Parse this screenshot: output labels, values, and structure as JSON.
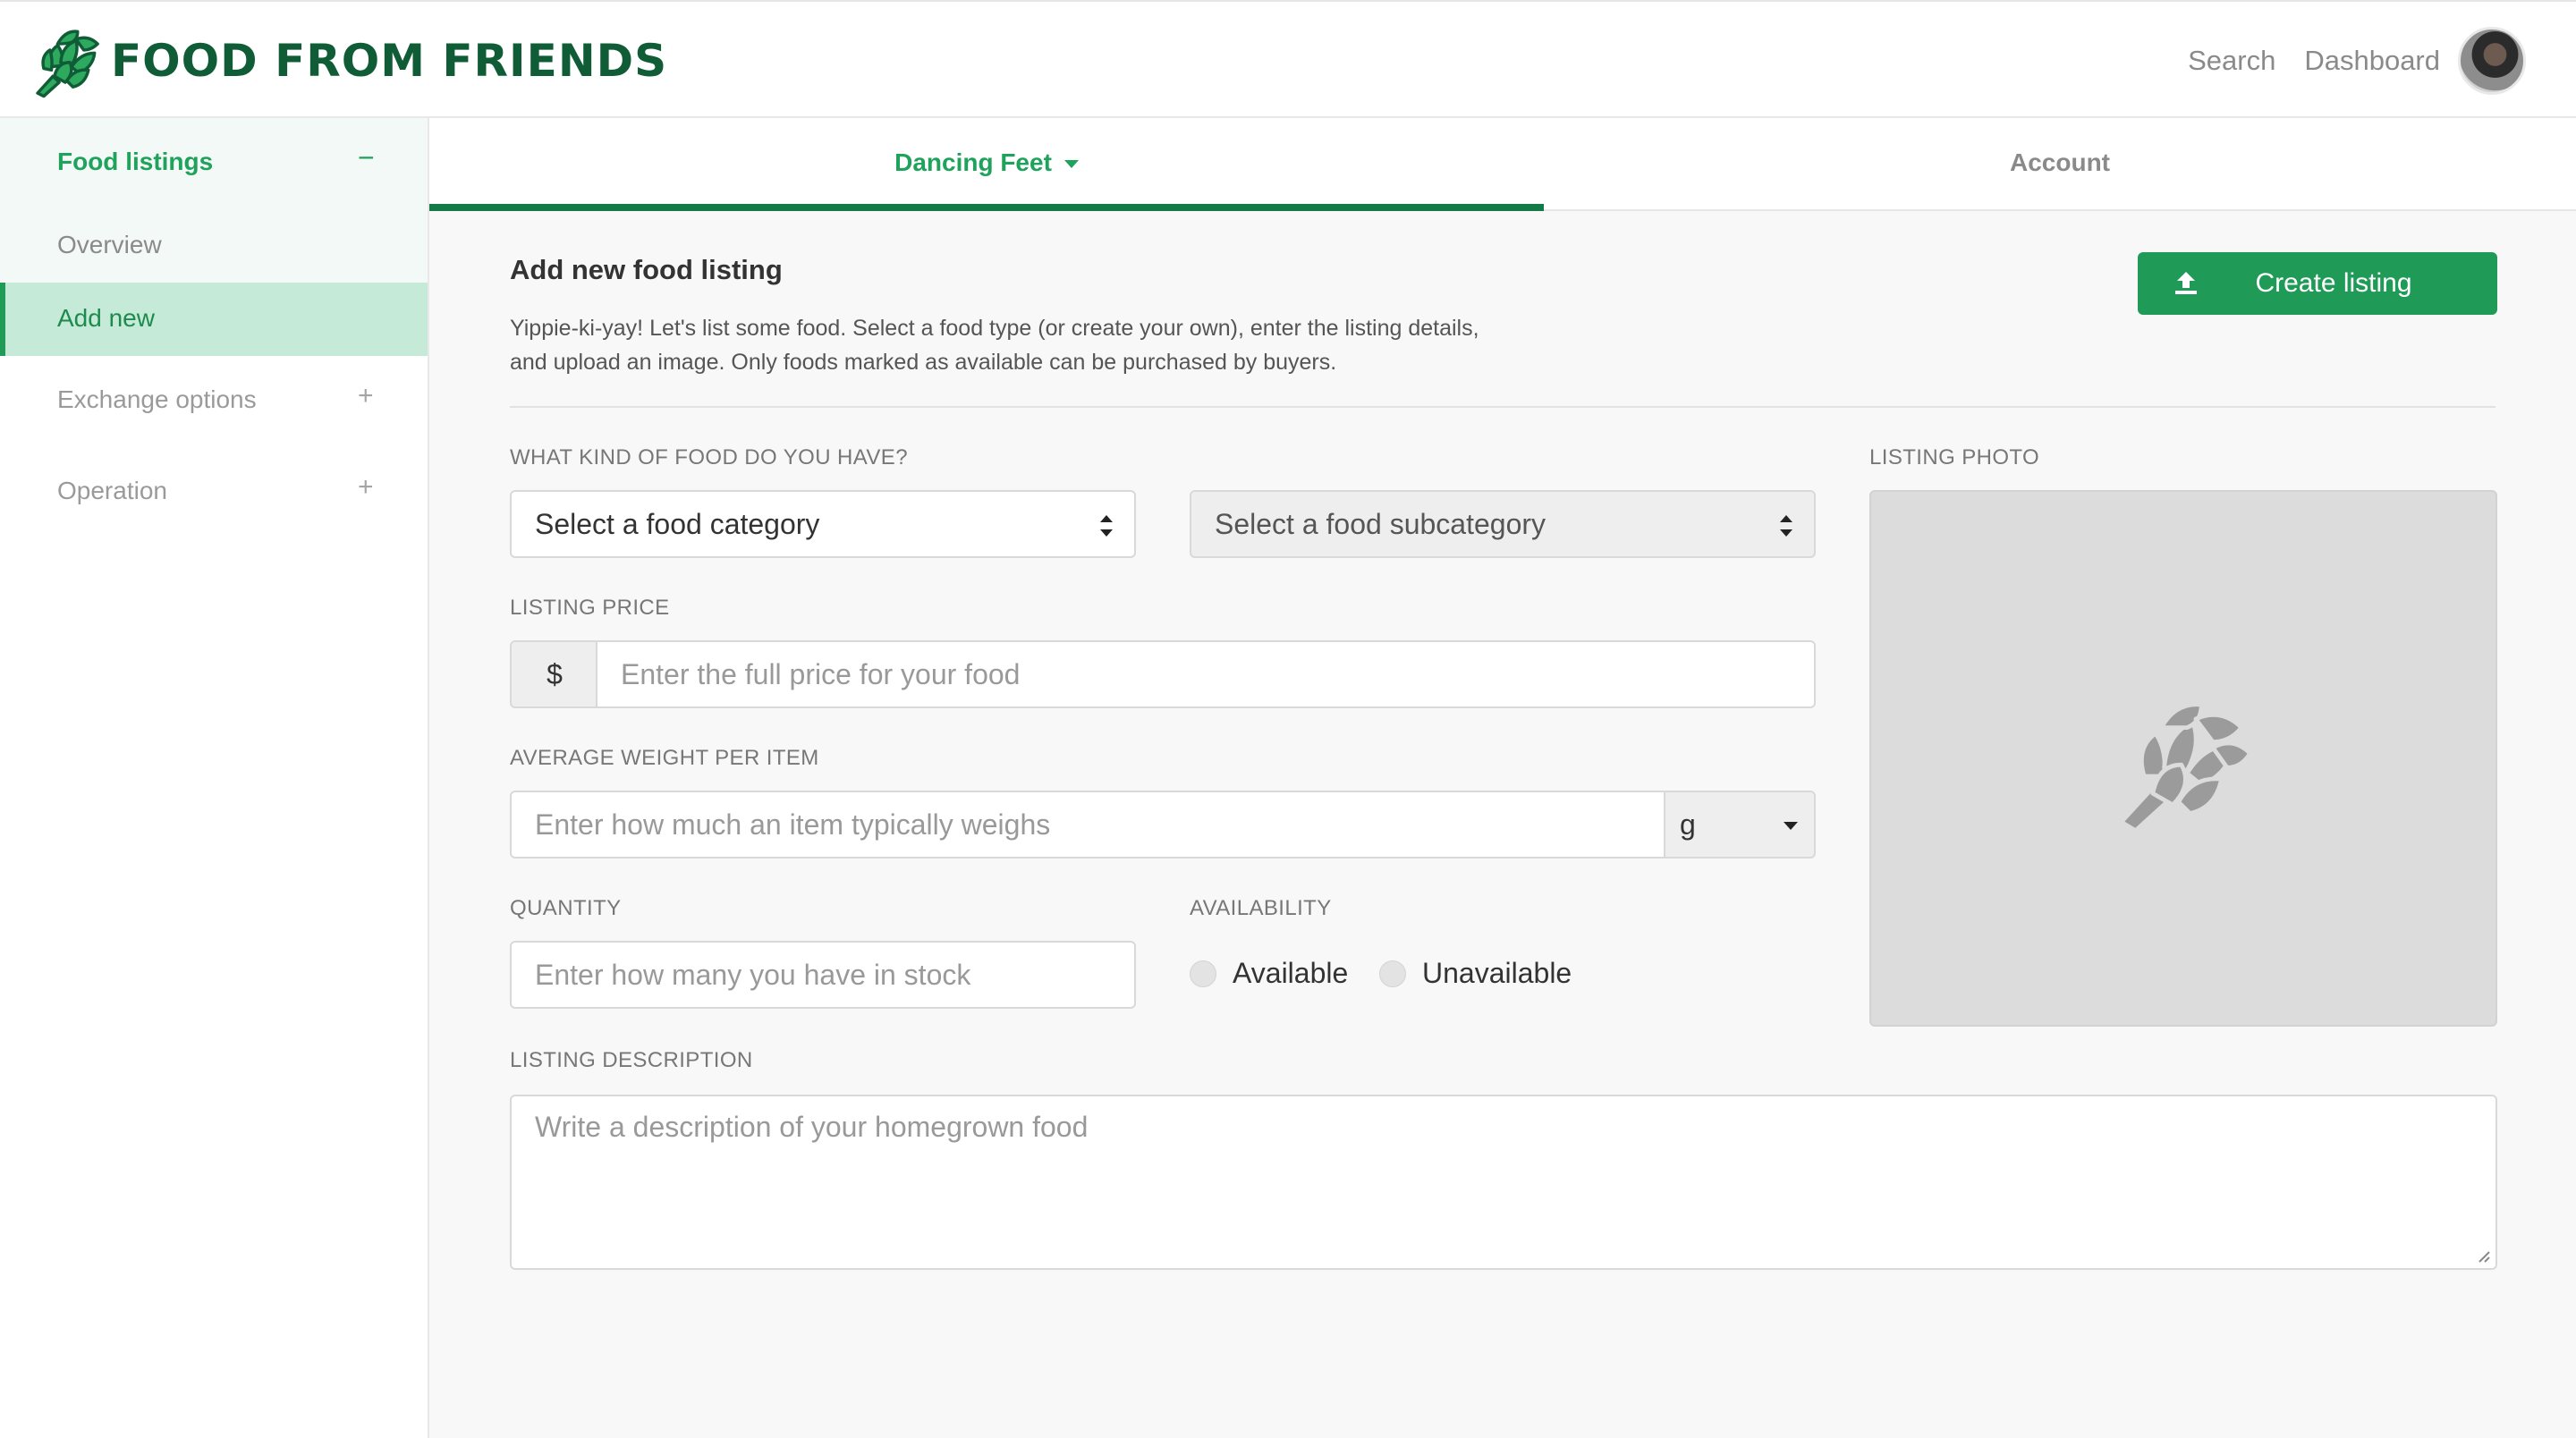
{
  "brand": {
    "name": "FOOD FROM FRIENDS",
    "color": "#0f5c37"
  },
  "topnav": {
    "search_label": "Search",
    "dashboard_label": "Dashboard"
  },
  "sidebar": {
    "section_title": "Food listings",
    "section_toggle": "−",
    "items": [
      {
        "label": "Overview",
        "active": false
      },
      {
        "label": "Add new",
        "active": true
      }
    ],
    "groups": [
      {
        "label": "Exchange options",
        "toggle": "+"
      },
      {
        "label": "Operation",
        "toggle": "+"
      }
    ]
  },
  "tabs": [
    {
      "label": "Dancing Feet",
      "active": true
    },
    {
      "label": "Account",
      "active": false
    }
  ],
  "page": {
    "title": "Add new food listing",
    "description": "Yippie-ki-yay! Let's list some food. Select a food type (or create your own), enter the listing details, and upload an image. Only foods marked as available can be purchased by buyers.",
    "create_button": "Create listing"
  },
  "form": {
    "food_kind_label": "WHAT KIND OF FOOD DO YOU HAVE?",
    "category_value": "Select a food category",
    "subcategory_value": "Select a food subcategory",
    "price_label": "LISTING PRICE",
    "price_addon": "$",
    "price_placeholder": "Enter the full price for your food",
    "weight_label": "AVERAGE WEIGHT PER ITEM",
    "weight_placeholder": "Enter how much an item typically weighs",
    "weight_unit": "g",
    "quantity_label": "QUANTITY",
    "quantity_placeholder": "Enter how many you have in stock",
    "availability_label": "AVAILABILITY",
    "availability_options": [
      "Available",
      "Unavailable"
    ],
    "photo_label": "LISTING PHOTO",
    "description_label": "LISTING DESCRIPTION",
    "description_placeholder": "Write a description of your homegrown food"
  },
  "colors": {
    "accent": "#1f9a57",
    "accent_text": "#1fa35c",
    "active_bg": "#c5ebd8",
    "tab_underline": "#137a47"
  }
}
